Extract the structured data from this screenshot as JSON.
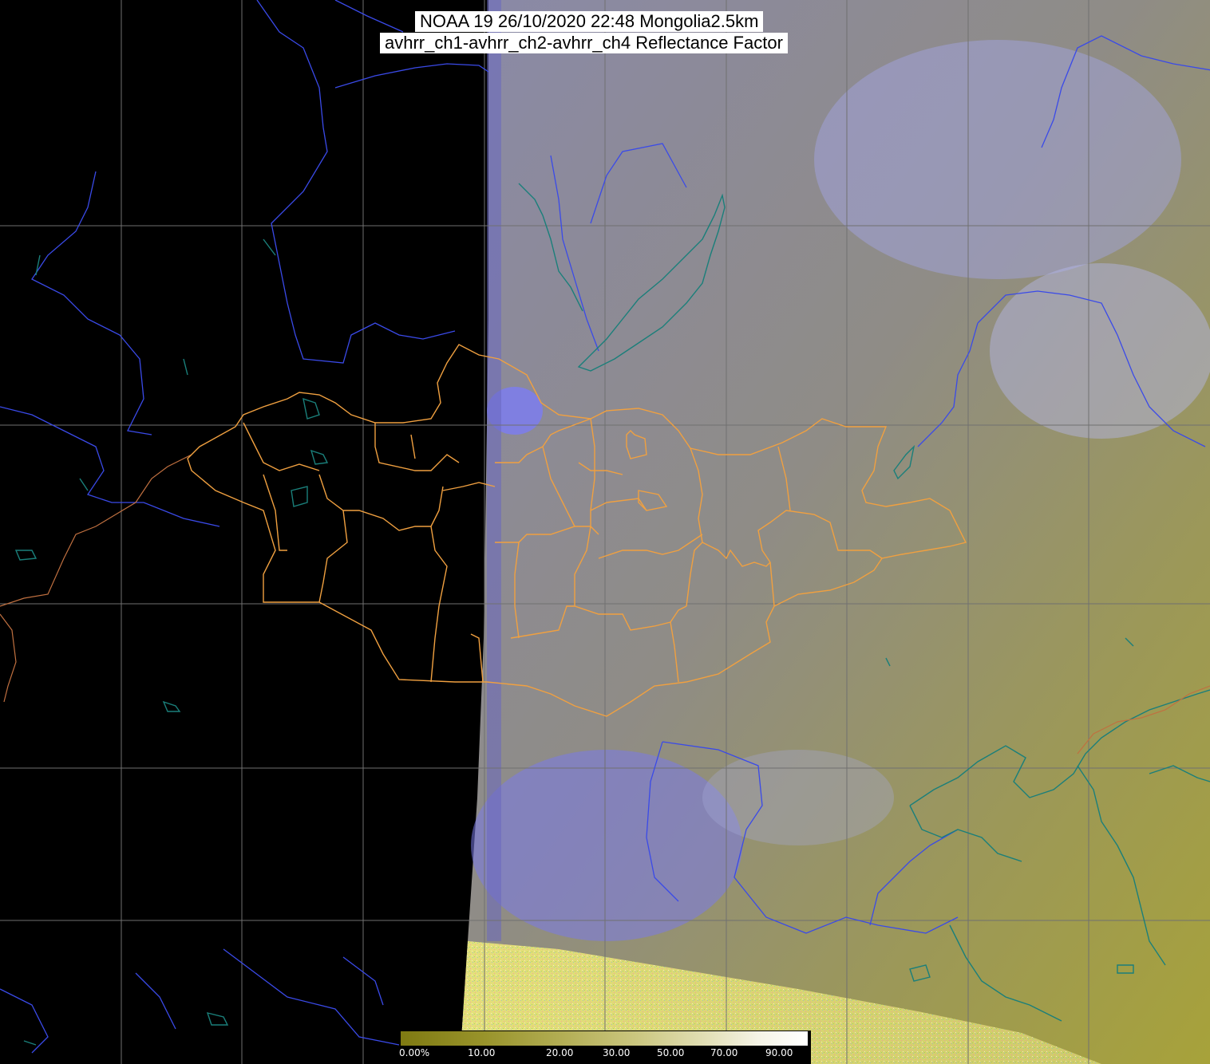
{
  "title": {
    "line1": "NOAA 19 26/10/2020 22:48 Mongolia2.5km",
    "line2": "avhrr_ch1-avhrr_ch2-avhrr_ch4 Reflectance Factor"
  },
  "colorbar": {
    "labels": [
      "0.00%",
      "10.00",
      "20.00",
      "30.00",
      "50.00",
      "70.00",
      "90.00"
    ]
  },
  "colors": {
    "no_data": "#000000",
    "scan_haze": "#8a8aa0",
    "cloud_blue": "#7a7af0",
    "land_olive": "#9a9650",
    "noise_yellow": "#d8d47a",
    "grid": "#707070",
    "rivers": "#3a4ae8",
    "coast_lakes": "#1a7f7a",
    "mongolia_provinces": "#f0a040",
    "other_borders": "#c07040",
    "title_bg": "#ffffff"
  }
}
